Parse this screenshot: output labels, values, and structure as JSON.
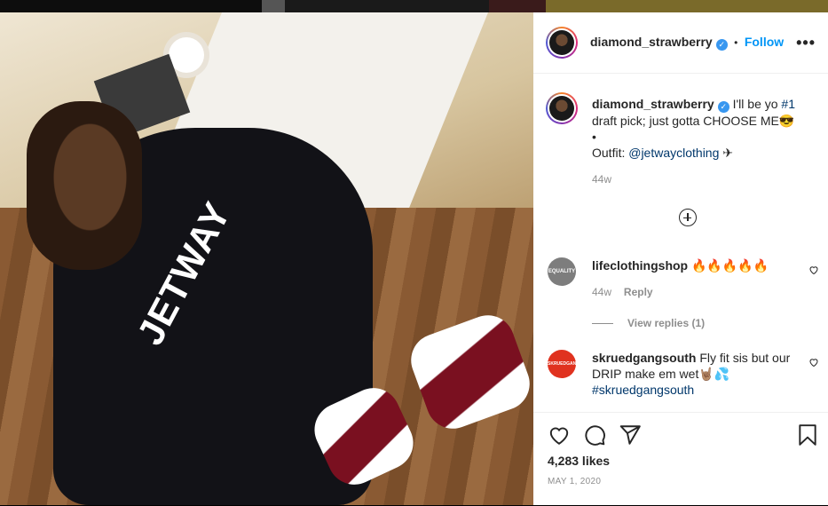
{
  "post": {
    "author": "diamond_strawberry",
    "follow_label": "Follow",
    "separator": "•",
    "more_label": "•••",
    "caption": {
      "line1_before": "I'll be yo ",
      "line1_hashtag": "#1",
      "line2": "draft pick; just gotta CHOOSE ME😎",
      "line3": "•",
      "line4_before": "Outfit: ",
      "line4_mention": "@jetwayclothing",
      "line4_after": " ✈",
      "time": "44w"
    },
    "photo_text": "JETWAY"
  },
  "comments": [
    {
      "username": "lifeclothingshop",
      "text": "🔥🔥🔥🔥🔥",
      "time": "44w",
      "reply_label": "Reply",
      "view_replies": "View replies (1)",
      "avatar_label": "EQUALITY",
      "avatar_color": "#8e8e8e"
    },
    {
      "username": "skruedgangsouth",
      "text": "Fly fit sis but our DRIP make em wet🤘🏽💦",
      "hashtag": "#skruedgangsouth",
      "avatar_label": "SKRUEDGANG",
      "avatar_color": "#e0321f"
    }
  ],
  "footer": {
    "likes": "4,283 likes",
    "date": "MAY 1, 2020"
  },
  "colors": {
    "link": "#00376b",
    "follow": "#0095f6",
    "verified": "#3897f0"
  }
}
